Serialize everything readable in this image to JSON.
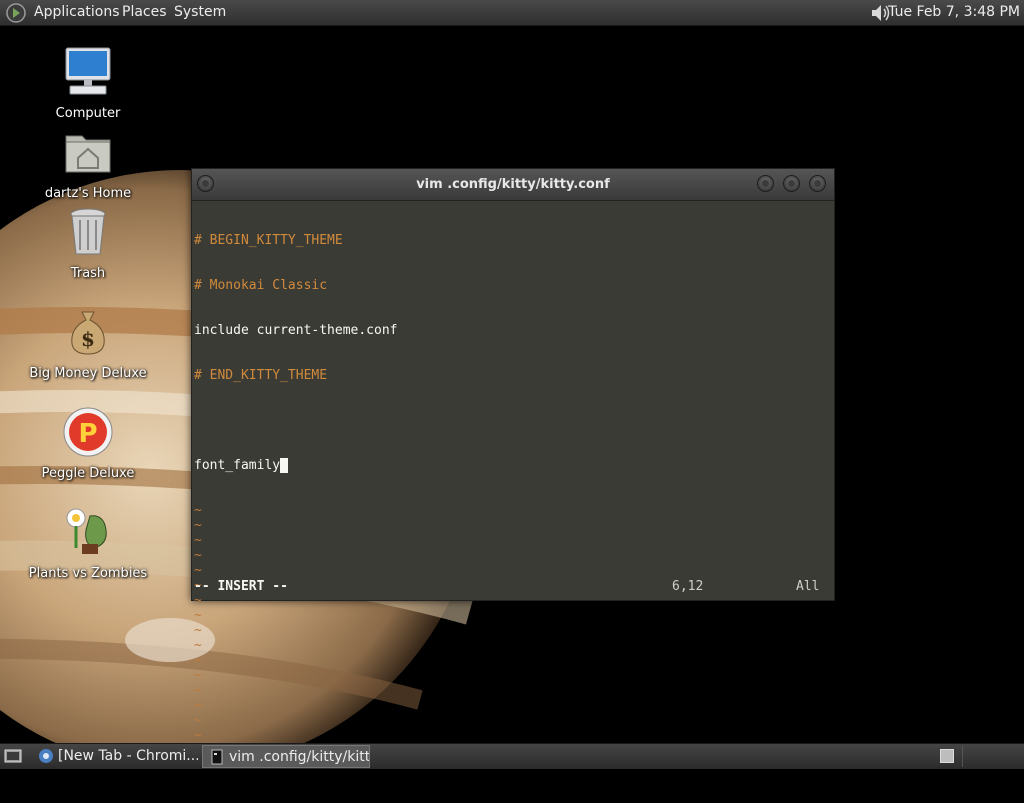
{
  "top_panel": {
    "menus": [
      "Applications",
      "Places",
      "System"
    ],
    "clock": "Tue Feb  7,  3:48 PM"
  },
  "desktop_icons": [
    {
      "label": "Computer",
      "icon": "computer-icon"
    },
    {
      "label": "dartz's Home",
      "icon": "home-folder-icon"
    },
    {
      "label": "Trash",
      "icon": "trash-icon"
    },
    {
      "label": "Big Money Deluxe",
      "icon": "money-bag-icon"
    },
    {
      "label": "Peggle Deluxe",
      "icon": "peggle-icon"
    },
    {
      "label": "Plants vs Zombies",
      "icon": "plants-vs-zombies-icon"
    }
  ],
  "terminal": {
    "title": "vim .config/kitty/kitty.conf",
    "lines": [
      {
        "text": "# BEGIN_KITTY_THEME",
        "kind": "comment"
      },
      {
        "text": "# Monokai Classic",
        "kind": "comment"
      },
      {
        "text": "include current-theme.conf",
        "kind": "normal"
      },
      {
        "text": "# END_KITTY_THEME",
        "kind": "comment"
      },
      {
        "text": "",
        "kind": "normal"
      },
      {
        "text": "font_family",
        "kind": "normal"
      }
    ],
    "tilde": "~",
    "tilde_count": 18,
    "mode": "-- INSERT --",
    "cursor_position": "6,12",
    "scroll_position": "All",
    "colors": {
      "comment": "#d08a3b",
      "background": "#3b3b36",
      "text": "#f8f8f2"
    }
  },
  "taskbar": {
    "tasks": [
      {
        "label": "[New Tab - Chromi...",
        "icon": "chromium-icon",
        "active": false
      },
      {
        "label": "vim .config/kitty/kitt...",
        "icon": "terminal-icon",
        "active": true
      }
    ]
  }
}
